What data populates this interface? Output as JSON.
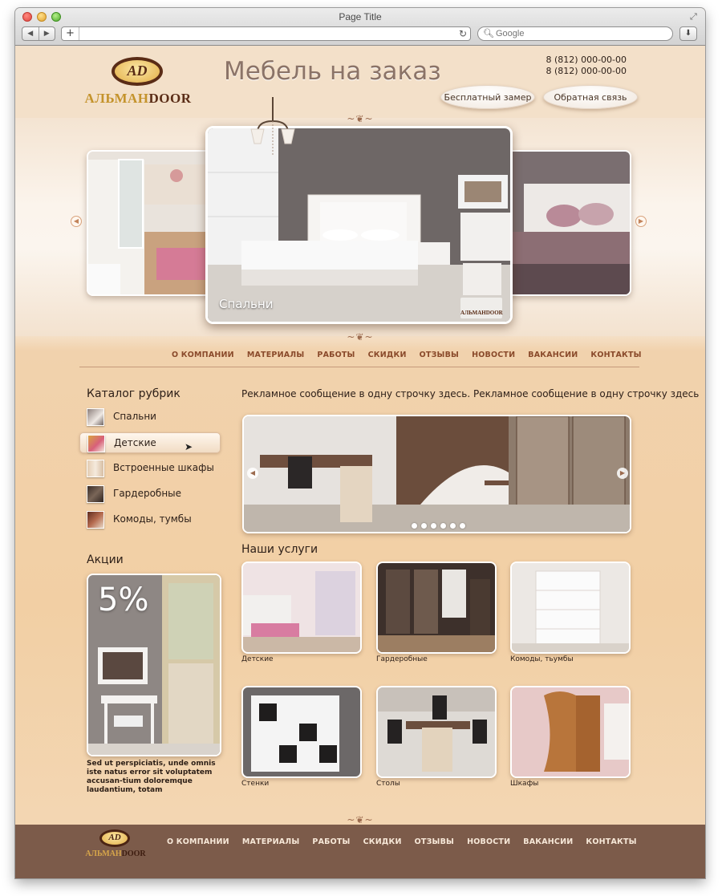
{
  "browser": {
    "title": "Page Title",
    "search_placeholder": "Google"
  },
  "header": {
    "logo_left": "АЛЬМАН",
    "logo_right": "DOOR",
    "logo_mark": "AD",
    "title": "Мебель на заказ",
    "phones": [
      "8 (812) 000-00-00",
      "8 (812) 000-00-00"
    ],
    "buttons": [
      "Бесплатный замер",
      "Обратная связь"
    ]
  },
  "slider": {
    "caption": "Спальни",
    "badge": "АЛЬМАНDOOR"
  },
  "menu": [
    "О КОМПАНИИ",
    "МАТЕРИАЛЫ",
    "РАБОТЫ",
    "СКИДКИ",
    "ОТЗЫВЫ",
    "НОВОСТИ",
    "ВАКАНСИИ",
    "КОНТАКТЫ"
  ],
  "catalog": {
    "title": "Каталог рубрик",
    "items": [
      "Спальни",
      "Детские",
      "Встроенные шкафы",
      "Гардеробные",
      "Комоды, тумбы"
    ],
    "active_index": 1
  },
  "promo": {
    "title": "Акции",
    "percent": "5%",
    "text": "Sed ut perspiciatis, unde omnis iste natus error sit voluptatem accusan-tium doloremque laudantium, totam"
  },
  "ad_line": "Рекламное сообщение в одну строчку здесь. Рекламное сообщение в одну строчку здесь",
  "carousel": {
    "slides": 6
  },
  "services": {
    "title": "Наши услуги",
    "items": [
      "Детские",
      "Гардеробные",
      "Комоды, тьумбы",
      "Стенки",
      "Столы",
      "Шкафы"
    ]
  },
  "footer": {
    "logo_left": "АЛЬМАН",
    "logo_right": "DOOR",
    "logo_mark": "AD",
    "menu": [
      "О КОМПАНИИ",
      "МАТЕРИАЛЫ",
      "РАБОТЫ",
      "СКИДКИ",
      "ОТЗЫВЫ",
      "НОВОСТИ",
      "ВАКАНСИИ",
      "КОНТАКТЫ"
    ]
  }
}
